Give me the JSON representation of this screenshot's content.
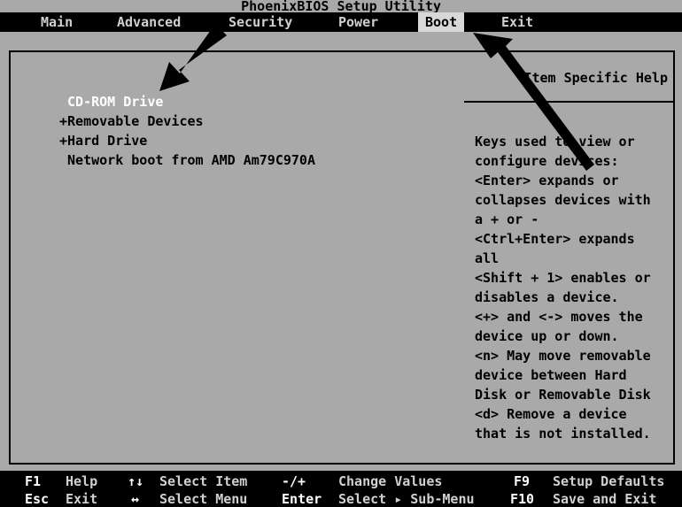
{
  "window": {
    "title": "PhoenixBIOS Setup Utility"
  },
  "menu": {
    "tabs": [
      {
        "label": "Main"
      },
      {
        "label": "Advanced"
      },
      {
        "label": "Security"
      },
      {
        "label": "Power"
      },
      {
        "label": "Boot",
        "active": true
      },
      {
        "label": "Exit"
      }
    ]
  },
  "boot_order": {
    "items": [
      {
        "label": " CD-ROM Drive",
        "selected": true
      },
      {
        "label": "+Removable Devices"
      },
      {
        "label": "+Hard Drive"
      },
      {
        "label": " Network boot from AMD Am79C970A"
      }
    ]
  },
  "help": {
    "title": "Item Specific Help",
    "lines": [
      "Keys used to view or",
      "configure devices:",
      "<Enter> expands or",
      "collapses devices with",
      "a + or -",
      "<Ctrl+Enter> expands",
      "all",
      "<Shift + 1> enables or",
      "disables a device.",
      "<+> and <-> moves the",
      "device up or down.",
      "<n> May move removable",
      "device between Hard",
      "Disk or Removable Disk",
      "<d> Remove a device",
      "that is not installed."
    ]
  },
  "footer": {
    "row1": {
      "f1_key": "F1",
      "f1_desc": "Help",
      "arrows_key": "↑↓",
      "arrows_desc": "Select Item",
      "pm_key": "-/+",
      "pm_desc": "Change Values",
      "f9_key": "F9",
      "f9_desc": "Setup Defaults"
    },
    "row2": {
      "esc_key": "Esc",
      "esc_desc": "Exit",
      "lr_key": "↔",
      "lr_desc": "Select Menu",
      "enter_key": "Enter",
      "enter_desc": "Select ▸ Sub-Menu",
      "f10_key": "F10",
      "f10_desc": "Save and Exit"
    }
  },
  "colors": {
    "screen_bg": "#a9a9a9",
    "bar_bg": "#000000",
    "highlight_text": "#ffffff"
  }
}
